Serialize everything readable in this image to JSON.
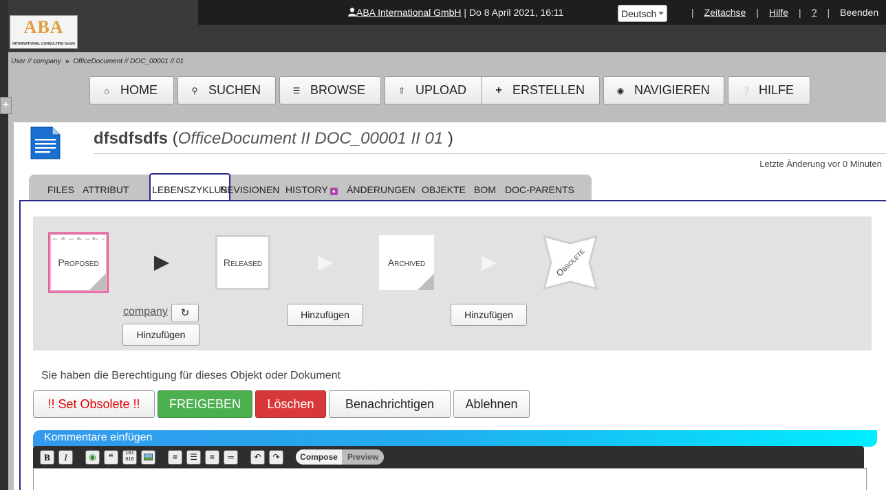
{
  "header": {
    "logo_text": "ABA",
    "logo_subtext": "INTERNATIONAL CONSULTING GmbH",
    "company_link": "ABA International GmbH",
    "datetime": " | Do 8 April 2021, 16:11",
    "language": "Deutsch",
    "links": [
      "Zeitachse",
      "Hilfe",
      "?",
      "Beenden"
    ]
  },
  "breadcrumb": {
    "first": "User // company",
    "separator": "»",
    "second": "OfficeDocument // DOC_00001 // 01"
  },
  "nav": {
    "home": "HOME",
    "search": "SUCHEN",
    "browse": "BROWSE",
    "upload": "UPLOAD",
    "create": "ERSTELLEN",
    "navigate": "NAVIGIEREN",
    "help": "HILFE"
  },
  "document": {
    "name": "dfsdfsdfs",
    "open_paren": " (",
    "type_ref": "OfficeDocument II DOC_00001 II  01",
    "close_paren": " )",
    "last_change": "Letzte Änderung vor 0 Minuten"
  },
  "tabs": [
    "FILES",
    "ATTRIBUT",
    "LEBENSZYKLUS",
    "REVISIONEN",
    "HISTORY",
    "ÄNDERUNGEN",
    "OBJEKTE",
    "BOM",
    "DOC-PARENTS"
  ],
  "active_tab": "LEBENSZYKLUS",
  "lifecycle": {
    "states": [
      "Proposed",
      "Released",
      "Archived",
      "Obsolete"
    ],
    "current_state": "Proposed",
    "signer": "company",
    "add_label": "Hinzufügen"
  },
  "permission_text": "Sie haben die Berechtigung für dieses Objekt oder Dokument",
  "actions": {
    "obsolete": "!! Set Obsolete  !!",
    "release": "FREIGEBEN",
    "delete": "Löschen",
    "notify": "Benachrichtigen",
    "reject": "Ablehnen"
  },
  "comments": {
    "title": "Kommentare einfügen",
    "compose": "Compose",
    "preview": "Preview"
  },
  "colors": {
    "release_green": "#4caf50",
    "delete_red": "#d9383a",
    "obsolete_text_red": "#e00000",
    "accent_navy": "#2a2a8a",
    "comment_gradient_start": "#3399ee",
    "comment_gradient_end": "#00eeff"
  }
}
